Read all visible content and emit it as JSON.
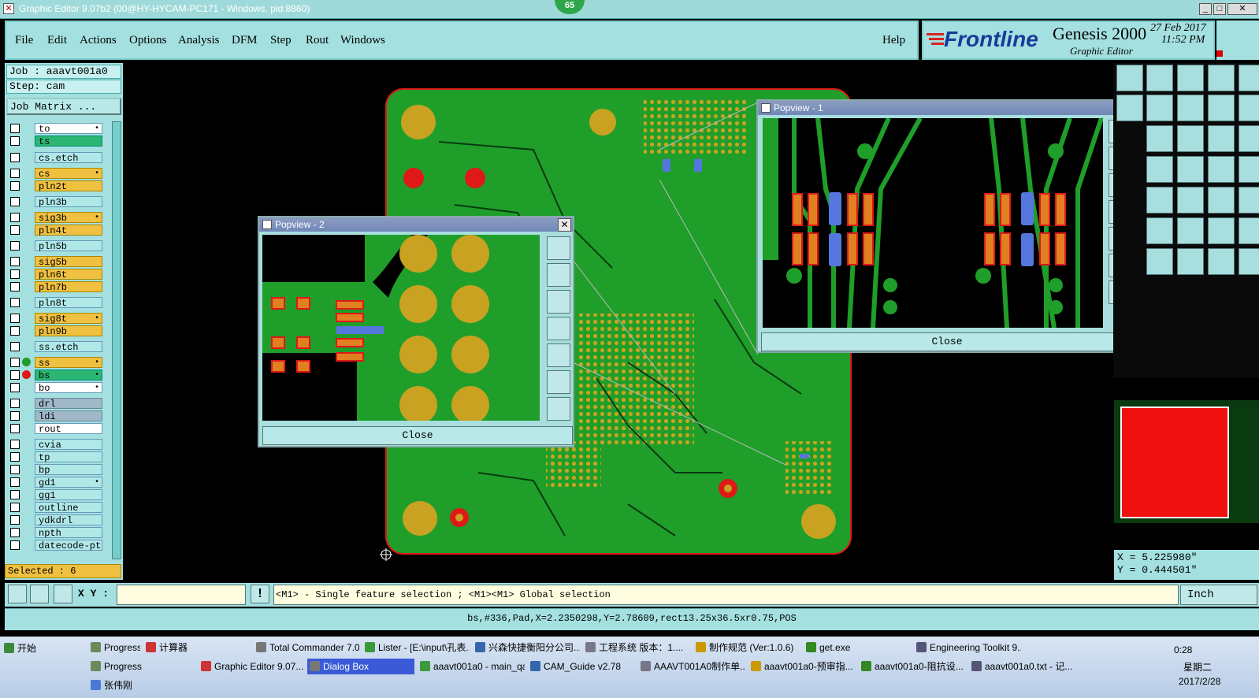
{
  "window": {
    "title": "Graphic Editor 9.07b2 (00@HY-HYCAM-PC171 - Windows, pid:8860)",
    "badge": "65"
  },
  "menu": [
    "File",
    "Edit",
    "Actions",
    "Options",
    "Analysis",
    "DFM",
    "Step",
    "Rout",
    "Windows"
  ],
  "help": "Help",
  "brand": {
    "logo": "Frontline",
    "product": "Genesis 2000",
    "subtitle": "Graphic Editor",
    "date": "27 Feb 2017",
    "time": "11:52 PM"
  },
  "job": {
    "job_label": "Job : aaavt001a0",
    "step_label": "Step: cam",
    "matrix_button": "Job Matrix ..."
  },
  "layers": [
    {
      "name": "to",
      "style": "white",
      "mark": "•",
      "dot": "none"
    },
    {
      "name": "ts",
      "style": "green",
      "dot": "none"
    },
    {
      "name": "cs.etch",
      "style": "cyan",
      "dot": "none"
    },
    {
      "name": "cs",
      "style": "gold",
      "mark": "•",
      "dot": "none"
    },
    {
      "name": "pln2t",
      "style": "gold",
      "dot": "none"
    },
    {
      "name": "pln3b",
      "style": "cyan",
      "dot": "none"
    },
    {
      "name": "sig3b",
      "style": "gold",
      "mark": "•",
      "dot": "none"
    },
    {
      "name": "pln4t",
      "style": "gold",
      "dot": "none"
    },
    {
      "name": "pln5b",
      "style": "cyan",
      "dot": "none"
    },
    {
      "name": "sig5b",
      "style": "gold",
      "dot": "none"
    },
    {
      "name": "pln6t",
      "style": "gold",
      "dot": "none"
    },
    {
      "name": "pln7b",
      "style": "gold",
      "dot": "none"
    },
    {
      "name": "pln8t",
      "style": "cyan",
      "dot": "none"
    },
    {
      "name": "sig8t",
      "style": "gold",
      "mark": "•",
      "dot": "none"
    },
    {
      "name": "pln9b",
      "style": "gold",
      "dot": "none"
    },
    {
      "name": "ss.etch",
      "style": "cyan",
      "dot": "none"
    },
    {
      "name": "ss",
      "style": "gold",
      "mark": "•",
      "dot": "green"
    },
    {
      "name": "bs",
      "style": "green",
      "mark": "•",
      "dot": "red"
    },
    {
      "name": "bo",
      "style": "white",
      "mark": "•",
      "dot": "none"
    },
    {
      "name": "drl",
      "style": "gray",
      "dot": "none"
    },
    {
      "name": "ldi",
      "style": "gray",
      "dot": "none"
    },
    {
      "name": "rout",
      "style": "white",
      "dot": "none"
    },
    {
      "name": "cvia",
      "style": "cyan",
      "dot": "none"
    },
    {
      "name": "tp",
      "style": "cyan",
      "dot": "none"
    },
    {
      "name": "bp",
      "style": "cyan",
      "dot": "none"
    },
    {
      "name": "gd1",
      "style": "cyan",
      "mark": "•",
      "dot": "none"
    },
    {
      "name": "gg1",
      "style": "cyan",
      "dot": "none"
    },
    {
      "name": "outline",
      "style": "cyan",
      "dot": "none"
    },
    {
      "name": "ydkdrl",
      "style": "cyan",
      "dot": "none"
    },
    {
      "name": "npth",
      "style": "cyan",
      "dot": "none"
    },
    {
      "name": "datecode-pt",
      "style": "cyan",
      "dot": "none"
    }
  ],
  "selected": "Selected : 6",
  "popview1": {
    "title": "Popview - 1",
    "close": "Close"
  },
  "popview2": {
    "title": "Popview - 2",
    "close": "Close"
  },
  "coords": {
    "x": "X = 5.225980\"",
    "y": "Y = 0.444501\""
  },
  "status": {
    "xy_label": "X Y :",
    "xy_value": "",
    "hint": "<M1> - Single feature selection ; <M1><M1> Global selection",
    "units": "Inch"
  },
  "feature_info": "bs,#336,Pad,X=2.2350298,Y=2.78609,rect13.25x36.5xr0.75,POS",
  "taskbar": {
    "start": "开始",
    "row1": [
      "Progress",
      "计算器",
      "Total Commander 7.0 ...",
      "Lister - [E:\\input\\孔表...",
      "兴森快捷衡阳分公司...",
      "工程系统  版本：1....",
      "制作规范 (Ver:1.0.6)",
      "get.exe",
      "Engineering Toolkit 9...."
    ],
    "row2": [
      "Progress",
      "Graphic Editor 9.07...",
      "Dialog Box",
      "aaavt001a0 - main_qa",
      "CAM_Guide v2.78",
      "AAAVT001A0制作单...",
      "aaavt001a0-预审指...",
      "aaavt001a0-阻抗设...",
      "aaavt001a0.txt - 记..."
    ],
    "row3": "张伟刚",
    "clock": "0:28",
    "weekday": "星期二",
    "date": "2017/2/28"
  },
  "colors": {
    "board": "#1f9e2a",
    "pad": "#c9a222",
    "outline": "#e01818",
    "highlight": "#5577dd",
    "panel": "#a4e0e0"
  }
}
